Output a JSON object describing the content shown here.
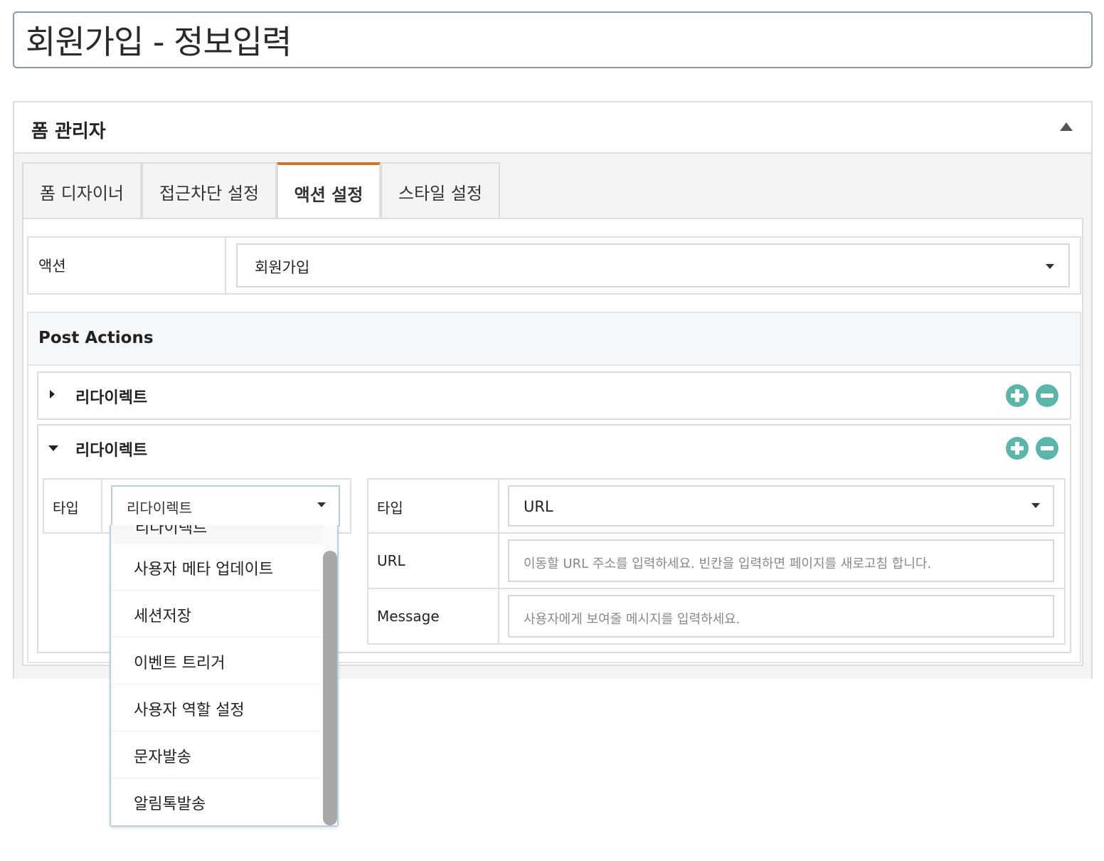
{
  "page": {
    "title": "회원가입 - 정보입력"
  },
  "panel": {
    "title": "폼 관리자",
    "tabs": [
      {
        "label": "폼 디자이너",
        "active": false
      },
      {
        "label": "접근차단 설정",
        "active": false
      },
      {
        "label": "액션 설정",
        "active": true
      },
      {
        "label": "스타일 설정",
        "active": false
      }
    ]
  },
  "action": {
    "label": "액션",
    "value": "회원가입"
  },
  "post_actions": {
    "title": "Post Actions",
    "items": [
      {
        "title": "리다이렉트",
        "expanded": false
      },
      {
        "title": "리다이렉트",
        "expanded": true
      }
    ]
  },
  "redirect_form": {
    "left": {
      "type_label": "타입",
      "type_value": "리다이렉트"
    },
    "right": {
      "type_label": "타입",
      "type_value": "URL",
      "url_label": "URL",
      "url_placeholder": "이동할 URL 주소를 입력하세요. 빈칸을 입력하면 페이지를 새로고침 합니다.",
      "message_label": "Message",
      "message_placeholder": "사용자에게 보여줄 메시지를 입력하세요."
    }
  },
  "dropdown": {
    "partial_item": "리다이렉트",
    "items": [
      "사용자 메타 업데이트",
      "세션저장",
      "이벤트 트리거",
      "사용자 역할 설정",
      "문자발송",
      "알림톡발송"
    ]
  },
  "colors": {
    "tab_active_accent": "#c8782f",
    "circle_button": "#5bb5a8"
  }
}
